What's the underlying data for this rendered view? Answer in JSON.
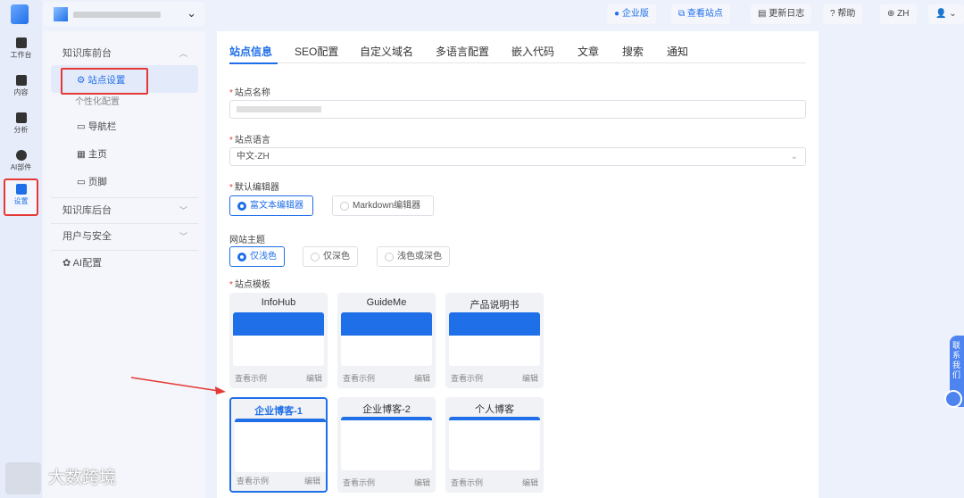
{
  "rail": [
    {
      "label": "工作台"
    },
    {
      "label": "内容"
    },
    {
      "label": "分析"
    },
    {
      "label": "AI部件"
    },
    {
      "label": "设置"
    }
  ],
  "header": {
    "buttons": [
      "企业版",
      "查看站点",
      "更新日志",
      "帮助",
      "ZH"
    ]
  },
  "sidebar": {
    "sections": [
      {
        "label": "知识库前台"
      },
      {
        "label": "知识库后台"
      },
      {
        "label": "用户与安全"
      },
      {
        "label": "AI配置"
      }
    ],
    "items": [
      {
        "label": "站点设置"
      },
      {
        "label": "个性化配置"
      },
      {
        "label": "导航栏"
      },
      {
        "label": "主页"
      },
      {
        "label": "页脚"
      }
    ]
  },
  "tabs": [
    "站点信息",
    "SEO配置",
    "自定义域名",
    "多语言配置",
    "嵌入代码",
    "文章",
    "搜索",
    "通知"
  ],
  "form": {
    "name_label": "站点名称",
    "lang_label": "站点语言",
    "lang_value": "中文-ZH",
    "editor_label": "默认编辑器",
    "editors": [
      "富文本编辑器",
      "Markdown编辑器"
    ],
    "theme_label": "网站主题",
    "themes": [
      "仅浅色",
      "仅深色",
      "浅色或深色"
    ],
    "template_label": "站点模板"
  },
  "templates": [
    {
      "name": "InfoHub"
    },
    {
      "name": "GuideMe"
    },
    {
      "name": "产品说明书"
    },
    {
      "name": "企业博客-1"
    },
    {
      "name": "企业博客-2"
    },
    {
      "name": "个人博客"
    }
  ],
  "template_actions": {
    "view": "查看示例",
    "edit": "编辑"
  },
  "contact": "联系我们",
  "watermark": "大数跨境",
  "colors": {
    "accent": "#1f6fe8",
    "highlight": "#e53935"
  }
}
